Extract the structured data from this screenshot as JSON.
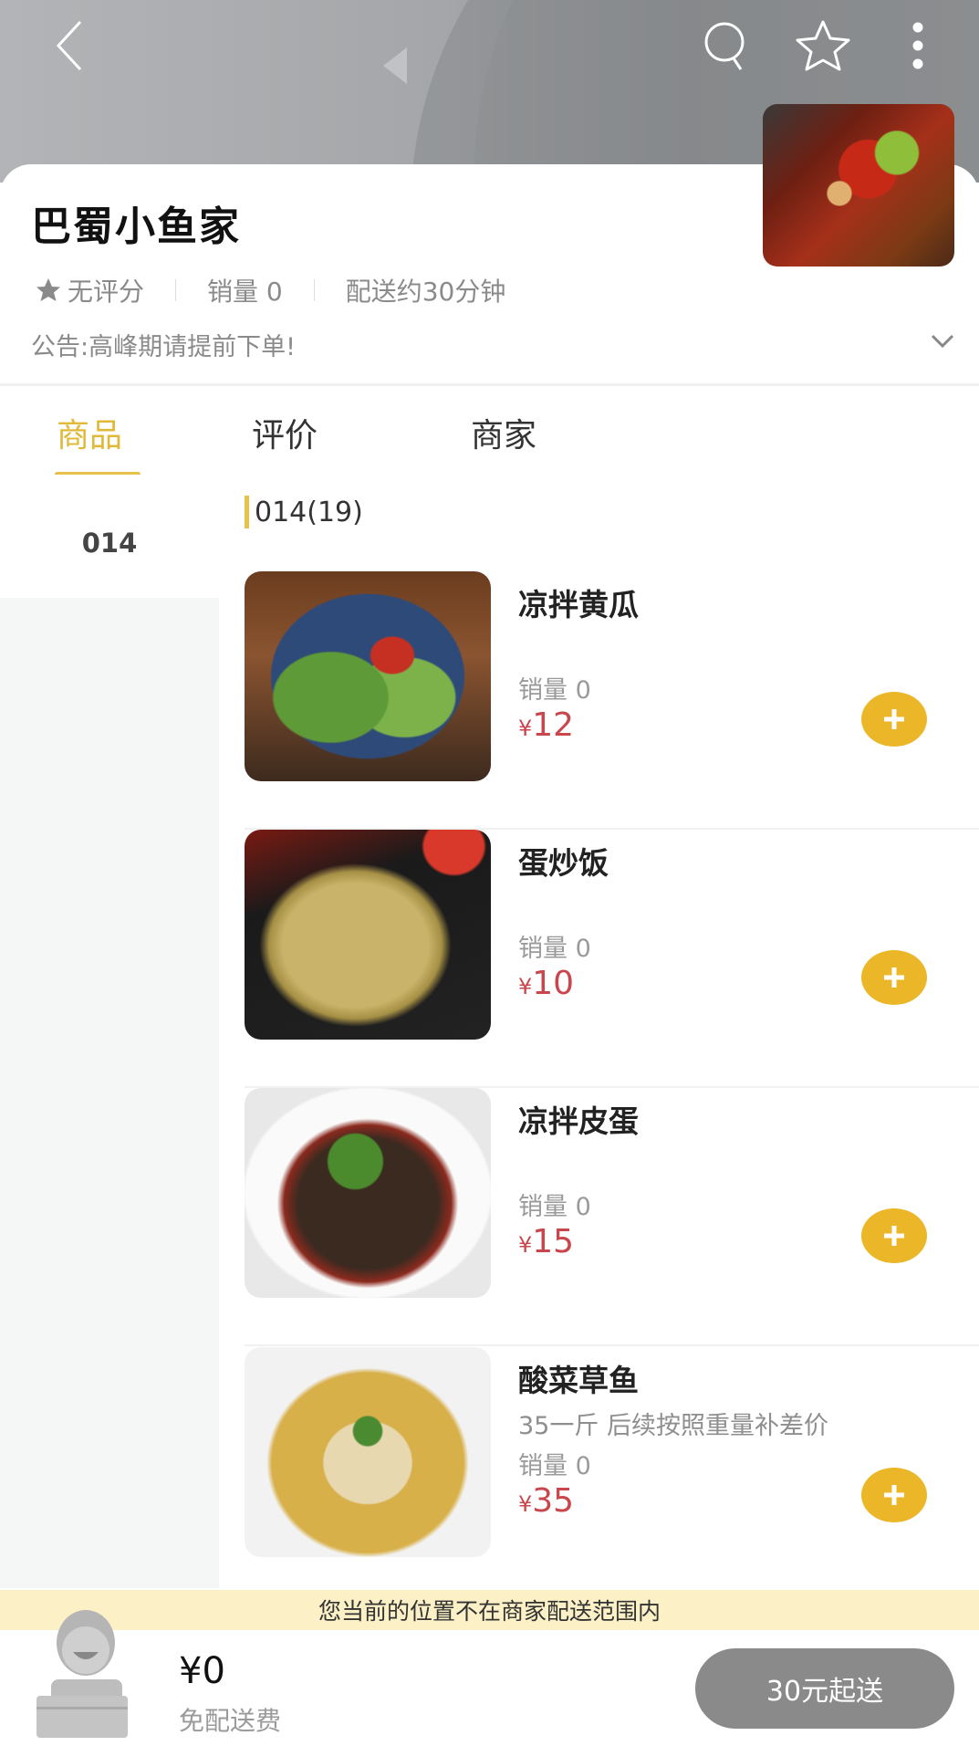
{
  "header": {
    "back_icon": "chevron-left-icon",
    "search_icon": "search-icon",
    "favorite_icon": "star-outline-icon",
    "more_icon": "more-vertical-icon"
  },
  "shop": {
    "name": "巴蜀小鱼家",
    "rating": "无评分",
    "sales": "销量 0",
    "delivery_time": "配送约30分钟",
    "notice": "公告:高峰期请提前下单!"
  },
  "tabs": [
    {
      "label": "商品",
      "active": true
    },
    {
      "label": "评价",
      "active": false
    },
    {
      "label": "商家",
      "active": false
    }
  ],
  "sidebar": {
    "categories": [
      {
        "label": "014",
        "selected": true
      }
    ]
  },
  "section": {
    "title": "014(19)"
  },
  "products": [
    {
      "name": "凉拌黄瓜",
      "desc": "",
      "sales": "销量 0",
      "currency": "¥",
      "price": "12"
    },
    {
      "name": "蛋炒饭",
      "desc": "",
      "sales": "销量 0",
      "currency": "¥",
      "price": "10"
    },
    {
      "name": "凉拌皮蛋",
      "desc": "",
      "sales": "销量 0",
      "currency": "¥",
      "price": "15"
    },
    {
      "name": "酸菜草鱼",
      "desc": "35一斤  后续按照重量补差价",
      "sales": "销量 0",
      "currency": "¥",
      "price": "35"
    }
  ],
  "cart": {
    "out_of_range_notice": "您当前的位置不在商家配送范围内",
    "total": "¥0",
    "delivery_fee": "免配送费",
    "checkout_label": "30元起送"
  },
  "colors": {
    "accent": "#e6c24a",
    "add_button": "#ebb728",
    "price": "#c9474c",
    "checkout_disabled": "#8a8a8a",
    "notice_banner": "#fbf0c6"
  }
}
